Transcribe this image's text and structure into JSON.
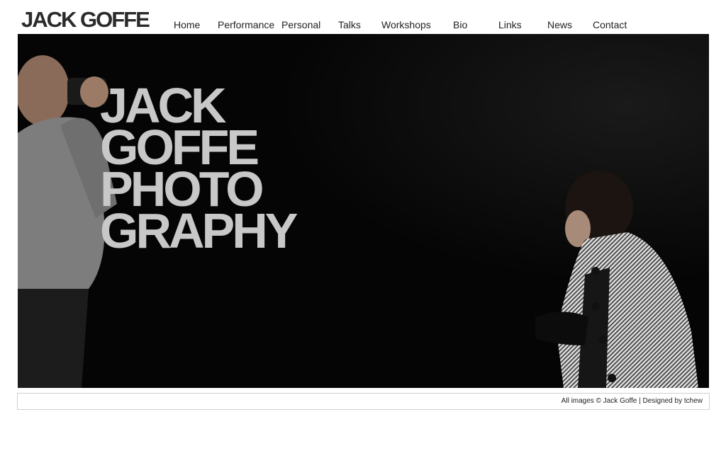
{
  "header": {
    "brand": "JACK GOFFE"
  },
  "nav": {
    "items": [
      {
        "label": "Home"
      },
      {
        "label": "Performance"
      },
      {
        "label": "Personal"
      },
      {
        "label": "Talks"
      },
      {
        "label": "Workshops"
      },
      {
        "label": "Bio"
      },
      {
        "label": "Links"
      },
      {
        "label": "News"
      },
      {
        "label": "Contact"
      }
    ]
  },
  "hero": {
    "title_lines": [
      "JACK",
      "GOFFE",
      "PHOTO",
      "GRAPHY"
    ]
  },
  "footer": {
    "text": "All images © Jack Goffe | Designed by tchew"
  },
  "colors": {
    "hero_background": "#050505",
    "title_text": "#c8c8c8",
    "brand_text": "#2b2b2b"
  }
}
